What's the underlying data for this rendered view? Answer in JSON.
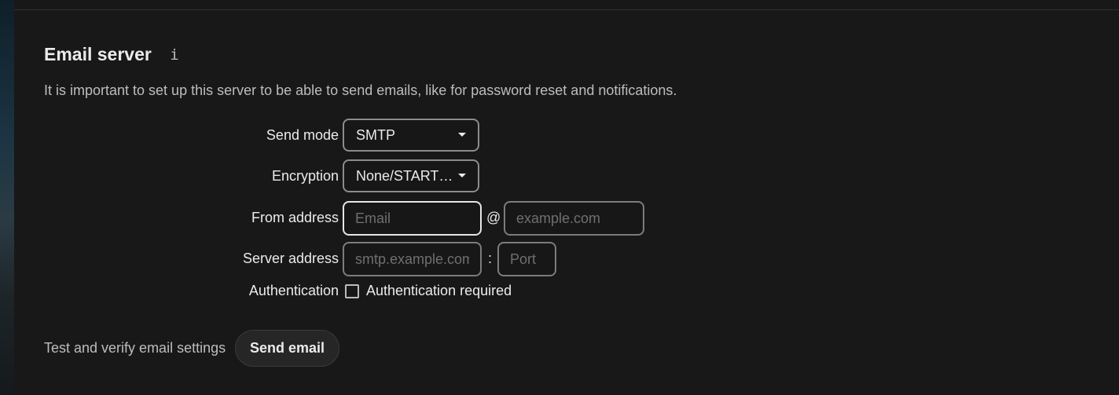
{
  "section": {
    "title": "Email server",
    "info_icon": "i",
    "description": "It is important to set up this server to be able to send emails, like for password reset and notifications."
  },
  "form": {
    "send_mode": {
      "label": "Send mode",
      "value": "SMTP"
    },
    "encryption": {
      "label": "Encryption",
      "value": "None/STARTTLS"
    },
    "from_address": {
      "label": "From address",
      "email_placeholder": "Email",
      "at_symbol": "@",
      "domain_placeholder": "example.com"
    },
    "server_address": {
      "label": "Server address",
      "host_placeholder": "smtp.example.com",
      "colon": ":",
      "port_placeholder": "Port"
    },
    "authentication": {
      "label": "Authentication",
      "checkbox_label": "Authentication required",
      "checked": false
    }
  },
  "test": {
    "label": "Test and verify email settings",
    "button_label": "Send email"
  },
  "colors": {
    "background": "#181818",
    "text": "#ebebeb",
    "muted_text": "#bdbdbd",
    "placeholder": "#6f6f6f",
    "border": "#8c8c8c"
  }
}
